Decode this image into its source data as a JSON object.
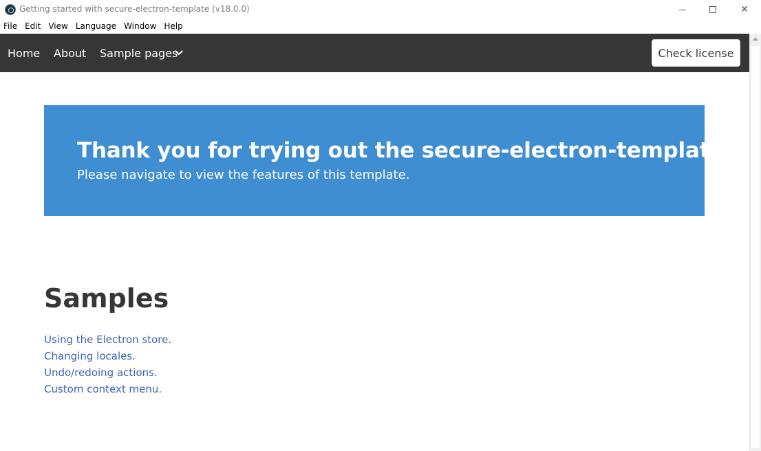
{
  "window": {
    "title": "Getting started with secure-electron-template (v18.0.0)",
    "controls": {
      "minimize_icon": "minimize-icon",
      "maximize_icon": "maximize-icon",
      "close_icon": "close-icon",
      "close_glyph": "✕"
    }
  },
  "menubar": {
    "items": [
      "File",
      "Edit",
      "View",
      "Language",
      "Window",
      "Help"
    ]
  },
  "navbar": {
    "home": "Home",
    "about": "About",
    "samples": "Sample pages",
    "check_license": "Check license",
    "background": "#363636"
  },
  "hero": {
    "title": "Thank you for trying out the secure-electron-template!",
    "subtitle": "Please navigate to view the features of this template.",
    "background": "#3f8ed1"
  },
  "samples": {
    "heading": "Samples",
    "links": [
      "Using the Electron store.",
      "Changing locales.",
      "Undo/redoing actions.",
      "Custom context menu."
    ],
    "link_color": "#3e5fb8"
  }
}
